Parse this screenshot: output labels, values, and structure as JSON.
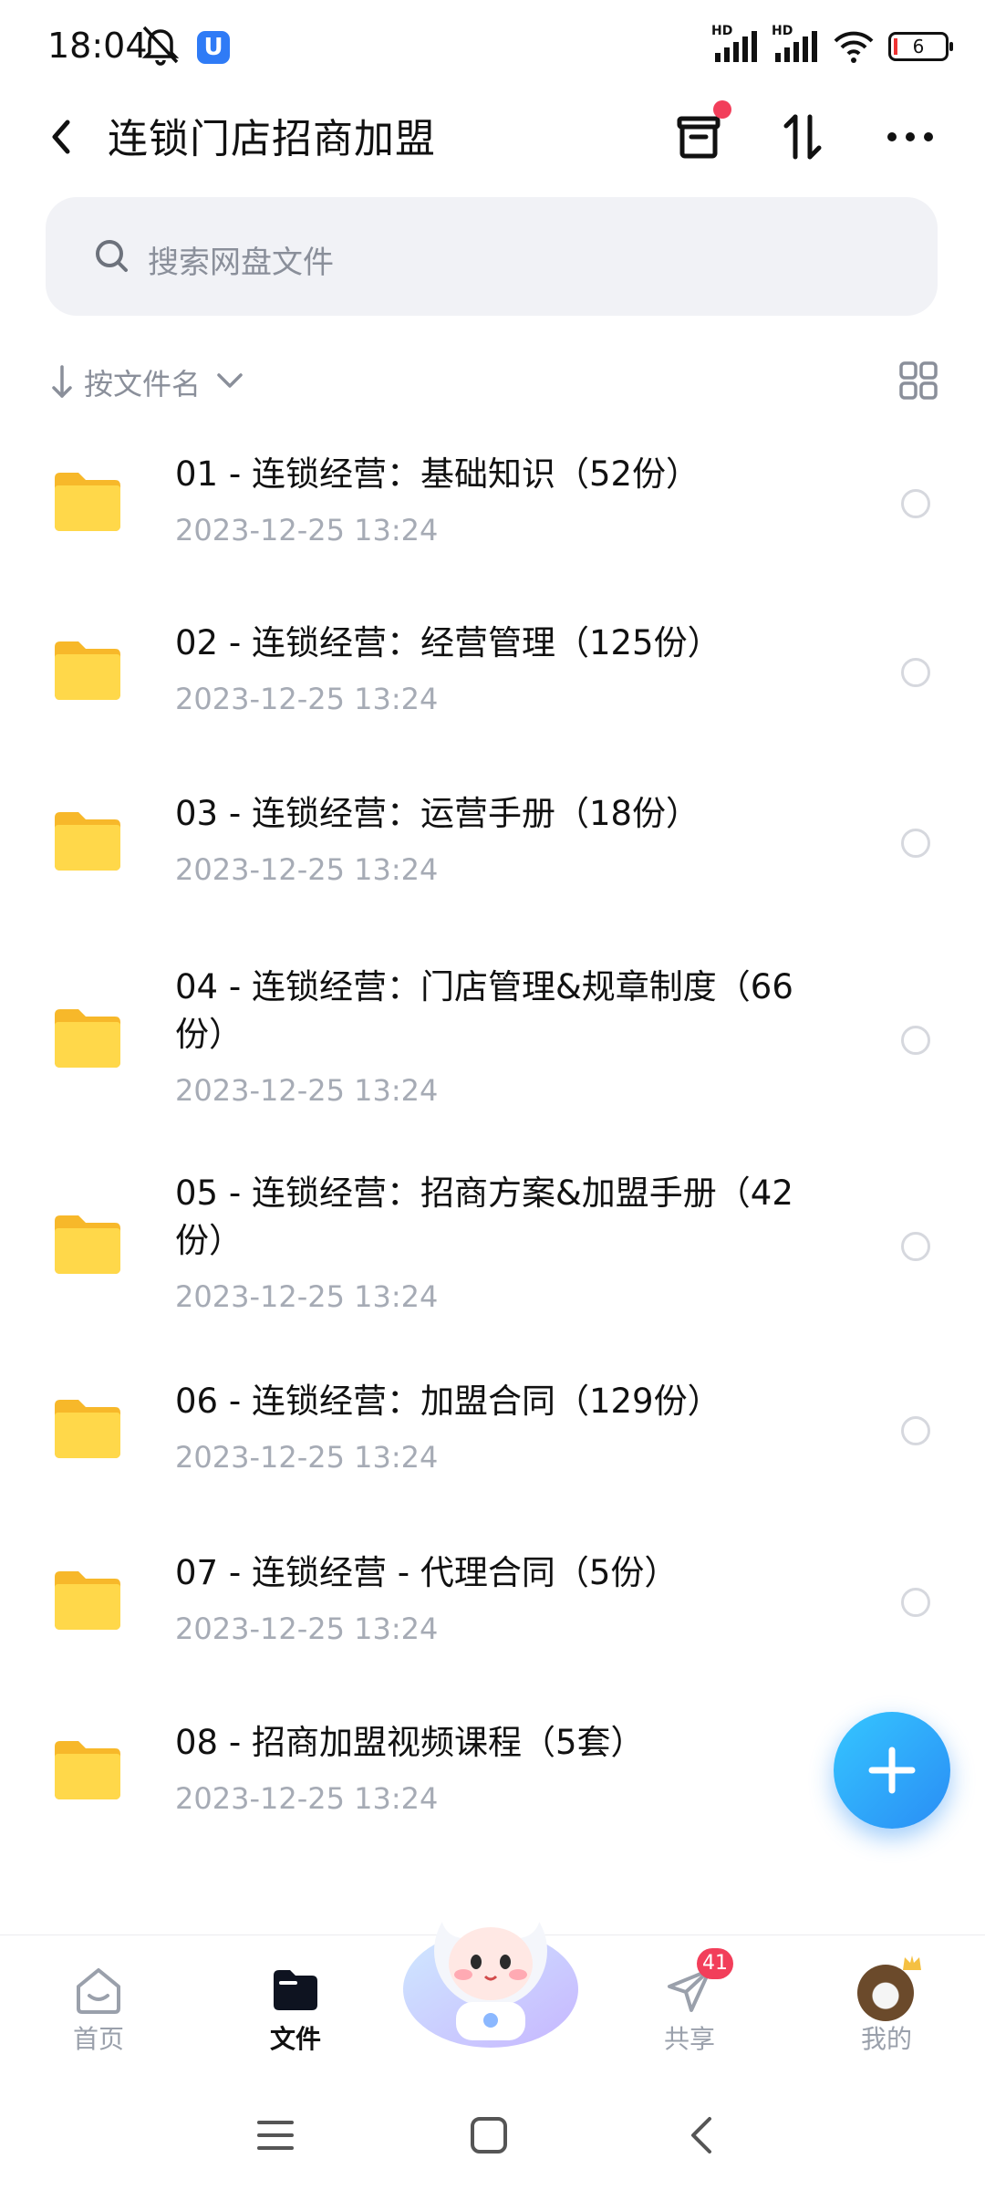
{
  "status_bar": {
    "time": "18:04",
    "signal1_label": "HD",
    "signal2_label": "HD",
    "battery": "6"
  },
  "header": {
    "title": "连锁门店招商加盟"
  },
  "search": {
    "placeholder": "搜索网盘文件"
  },
  "sort": {
    "label": "按文件名"
  },
  "files": [
    {
      "name": "01 - 连锁经营：基础知识（52份）",
      "date": "2023-12-25  13:24"
    },
    {
      "name": "02 - 连锁经营：经营管理（125份）",
      "date": "2023-12-25  13:24"
    },
    {
      "name": "03 - 连锁经营：运营手册（18份）",
      "date": "2023-12-25  13:24"
    },
    {
      "name": "04 - 连锁经营：门店管理&规章制度（66份）",
      "date": "2023-12-25  13:24"
    },
    {
      "name": "05 - 连锁经营：招商方案&加盟手册（42份）",
      "date": "2023-12-25  13:24"
    },
    {
      "name": "06 - 连锁经营：加盟合同（129份）",
      "date": "2023-12-25  13:24"
    },
    {
      "name": "07 - 连锁经营 - 代理合同（5份）",
      "date": "2023-12-25  13:24"
    },
    {
      "name": "08 - 招商加盟视频课程（5套）",
      "date": "2023-12-25  13:24"
    }
  ],
  "bottom_nav": {
    "home": "首页",
    "files": "文件",
    "share": "共享",
    "share_badge": "41",
    "mine": "我的"
  },
  "colors": {
    "accent": "#2a8df5",
    "folder": "#ffd43b",
    "badge": "#f23e5a"
  }
}
